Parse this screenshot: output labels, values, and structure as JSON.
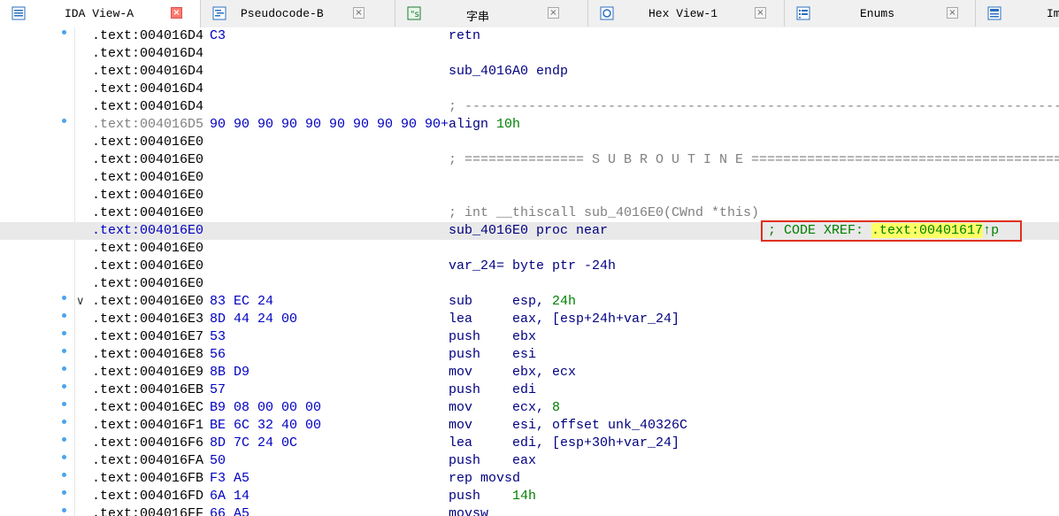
{
  "tabs": [
    {
      "label": "IDA View-A",
      "icon": "ida-view-icon",
      "active": true
    },
    {
      "label": "Pseudocode-B",
      "icon": "pseudocode-icon",
      "active": false
    },
    {
      "label": "字串",
      "icon": "strings-icon",
      "active": false
    },
    {
      "label": "Hex View-1",
      "icon": "hex-view-icon",
      "active": false
    },
    {
      "label": "Enums",
      "icon": "enums-icon",
      "active": false
    },
    {
      "label": "Im",
      "icon": "imports-icon",
      "active": false
    }
  ],
  "close_glyph": "×",
  "lines": [
    {
      "addr": ".text:004016D4",
      "bytes": "C3",
      "instr": "retn"
    },
    {
      "addr": ".text:004016D4",
      "bytes": "",
      "instr": ""
    },
    {
      "addr": ".text:004016D4",
      "bytes": "",
      "instr": "sub_4016A0 endp"
    },
    {
      "addr": ".text:004016D4",
      "bytes": "",
      "instr": ""
    },
    {
      "addr": ".text:004016D4",
      "bytes": "",
      "instr": "; ---------------------------------------------------------------------------"
    },
    {
      "addr": ".text:004016D5",
      "bytes": "90 90 90 90 90 90 90 90 90 90+",
      "instr_op": "align",
      "instr_num": "10h"
    },
    {
      "addr": ".text:004016E0",
      "bytes": "",
      "instr": ""
    },
    {
      "addr": ".text:004016E0",
      "bytes": "",
      "instr": "; =============== S U B R O U T I N E ======================================="
    },
    {
      "addr": ".text:004016E0",
      "bytes": "",
      "instr": ""
    },
    {
      "addr": ".text:004016E0",
      "bytes": "",
      "instr": ""
    },
    {
      "addr": ".text:004016E0",
      "bytes": "",
      "instr": "; int __thiscall sub_4016E0(CWnd *this)"
    },
    {
      "addr": ".text:004016E0",
      "bytes": "",
      "instr": "sub_4016E0 proc near"
    },
    {
      "addr": ".text:004016E0",
      "bytes": "",
      "instr": ""
    },
    {
      "addr": ".text:004016E0",
      "bytes": "",
      "instr": "var_24= byte ptr -24h"
    },
    {
      "addr": ".text:004016E0",
      "bytes": "",
      "instr": ""
    },
    {
      "addr": ".text:004016E0",
      "bytes": "83 EC 24",
      "instr_op": "sub     esp, ",
      "instr_num": "24h"
    },
    {
      "addr": ".text:004016E3",
      "bytes": "8D 44 24 00",
      "instr": "lea     eax, [esp+24h+var_24]"
    },
    {
      "addr": ".text:004016E7",
      "bytes": "53",
      "instr": "push    ebx"
    },
    {
      "addr": ".text:004016E8",
      "bytes": "56",
      "instr": "push    esi"
    },
    {
      "addr": ".text:004016E9",
      "bytes": "8B D9",
      "instr": "mov     ebx, ecx"
    },
    {
      "addr": ".text:004016EB",
      "bytes": "57",
      "instr": "push    edi"
    },
    {
      "addr": ".text:004016EC",
      "bytes": "B9 08 00 00 00",
      "instr_op": "mov     ecx, ",
      "instr_num": "8"
    },
    {
      "addr": ".text:004016F1",
      "bytes": "BE 6C 32 40 00",
      "instr": "mov     esi, offset unk_40326C"
    },
    {
      "addr": ".text:004016F6",
      "bytes": "8D 7C 24 0C",
      "instr": "lea     edi, [esp+30h+var_24]"
    },
    {
      "addr": ".text:004016FA",
      "bytes": "50",
      "instr": "push    eax"
    },
    {
      "addr": ".text:004016FB",
      "bytes": "F3 A5",
      "instr": "rep movsd"
    },
    {
      "addr": ".text:004016FD",
      "bytes": "6A 14",
      "instr_op": "push    ",
      "instr_num": "14h"
    },
    {
      "addr": ".text:004016FF",
      "bytes": "66 A5",
      "instr": "movsw"
    }
  ],
  "xref": {
    "label": "; CODE XREF: ",
    "target": ".text:00401617",
    "suffix": "↑p"
  },
  "colors": {
    "accent_dot": "#4aa3f0",
    "highlight_row": "#e9e9e9",
    "xref_box": "#e0301e",
    "xref_target_bg": "#ffff66"
  }
}
